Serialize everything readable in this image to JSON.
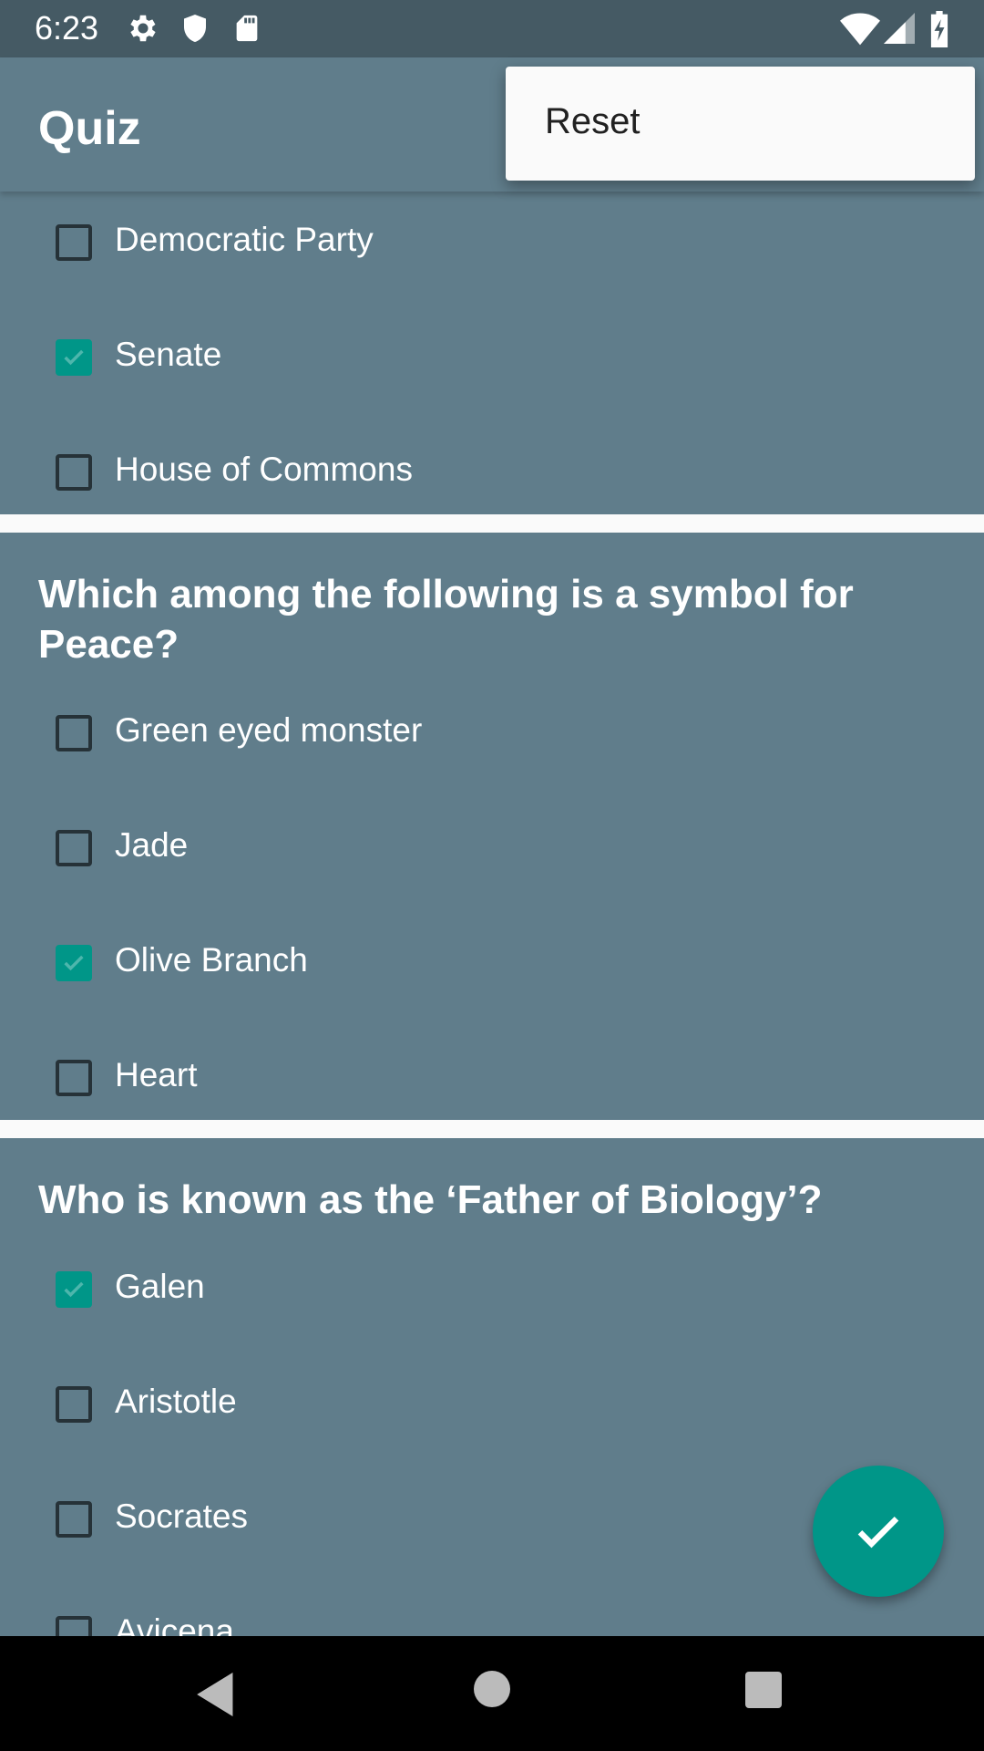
{
  "status_bar": {
    "time": "6:23",
    "left_icons": [
      "gear-icon",
      "shield-icon",
      "sd-card-icon"
    ],
    "right_icons": [
      "wifi-icon",
      "signal-icon",
      "battery-charging-icon"
    ]
  },
  "toolbar": {
    "title": "Quiz"
  },
  "menu": {
    "items": [
      {
        "label": "Reset"
      }
    ]
  },
  "questions": [
    {
      "text": "",
      "options": [
        {
          "label": "Democratic Party",
          "checked": false
        },
        {
          "label": "Senate",
          "checked": true
        },
        {
          "label": "House of Commons",
          "checked": false
        }
      ]
    },
    {
      "text": "Which among the following is a symbol for Peace?",
      "options": [
        {
          "label": "Green eyed monster",
          "checked": false
        },
        {
          "label": "Jade",
          "checked": false
        },
        {
          "label": "Olive Branch",
          "checked": true
        },
        {
          "label": "Heart",
          "checked": false
        }
      ]
    },
    {
      "text": "Who is known as the ‘Father of Biology’?",
      "options": [
        {
          "label": "Galen",
          "checked": true
        },
        {
          "label": "Aristotle",
          "checked": false
        },
        {
          "label": "Socrates",
          "checked": false
        },
        {
          "label": "Avicena",
          "checked": false
        }
      ]
    }
  ],
  "fab": {
    "icon": "check-icon"
  },
  "nav_bar": {
    "buttons": [
      "back-icon",
      "home-icon",
      "recents-icon"
    ]
  },
  "colors": {
    "primary": "#607D8B",
    "primary_dark": "#455A64",
    "accent": "#009688",
    "divider": "#FAFAFA"
  }
}
